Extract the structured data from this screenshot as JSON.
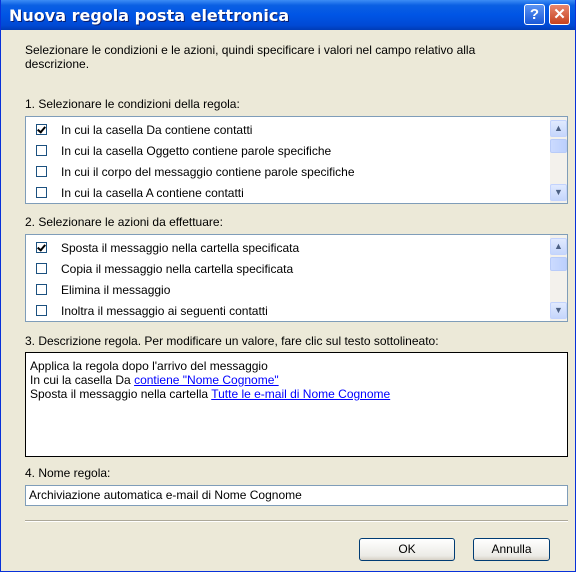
{
  "window": {
    "title": "Nuova regola posta elettronica"
  },
  "titlebar_buttons": {
    "help": "?",
    "close": "✕"
  },
  "intro_line1": "Selezionare le condizioni e le azioni, quindi specificare i valori nel campo relativo alla",
  "intro_line2": "descrizione.",
  "conditions": {
    "label": "1. Selezionare le condizioni della regola:",
    "items": [
      {
        "text": "In cui la casella Da contiene contatti",
        "checked": true
      },
      {
        "text": "In cui la casella Oggetto contiene parole specifiche",
        "checked": false
      },
      {
        "text": "In cui il corpo del messaggio contiene parole specifiche",
        "checked": false
      },
      {
        "text": "In cui la casella A contiene contatti",
        "checked": false
      }
    ]
  },
  "actions": {
    "label": "2. Selezionare le azioni da effettuare:",
    "items": [
      {
        "text": "Sposta il messaggio nella cartella specificata",
        "checked": true
      },
      {
        "text": "Copia il messaggio nella cartella specificata",
        "checked": false
      },
      {
        "text": "Elimina il messaggio",
        "checked": false
      },
      {
        "text": "Inoltra il messaggio ai seguenti contatti",
        "checked": false
      }
    ]
  },
  "description": {
    "label": "3. Descrizione regola. Per modificare un valore, fare clic sul testo sottolineato:",
    "line1": "Applica la regola dopo l'arrivo del messaggio",
    "line2_prefix": "In cui la casella Da ",
    "line2_link": "contiene \"Nome Cognome\"",
    "line3_prefix": "Sposta il messaggio nella cartella ",
    "line3_link": "Tutte le e-mail di Nome Cognome"
  },
  "rule_name": {
    "label": "4. Nome regola:",
    "value": "Archiviazione automatica e-mail di Nome Cognome"
  },
  "buttons": {
    "ok": "OK",
    "cancel": "Annulla"
  },
  "scroll_glyphs": {
    "up": "▲",
    "down": "▼"
  }
}
